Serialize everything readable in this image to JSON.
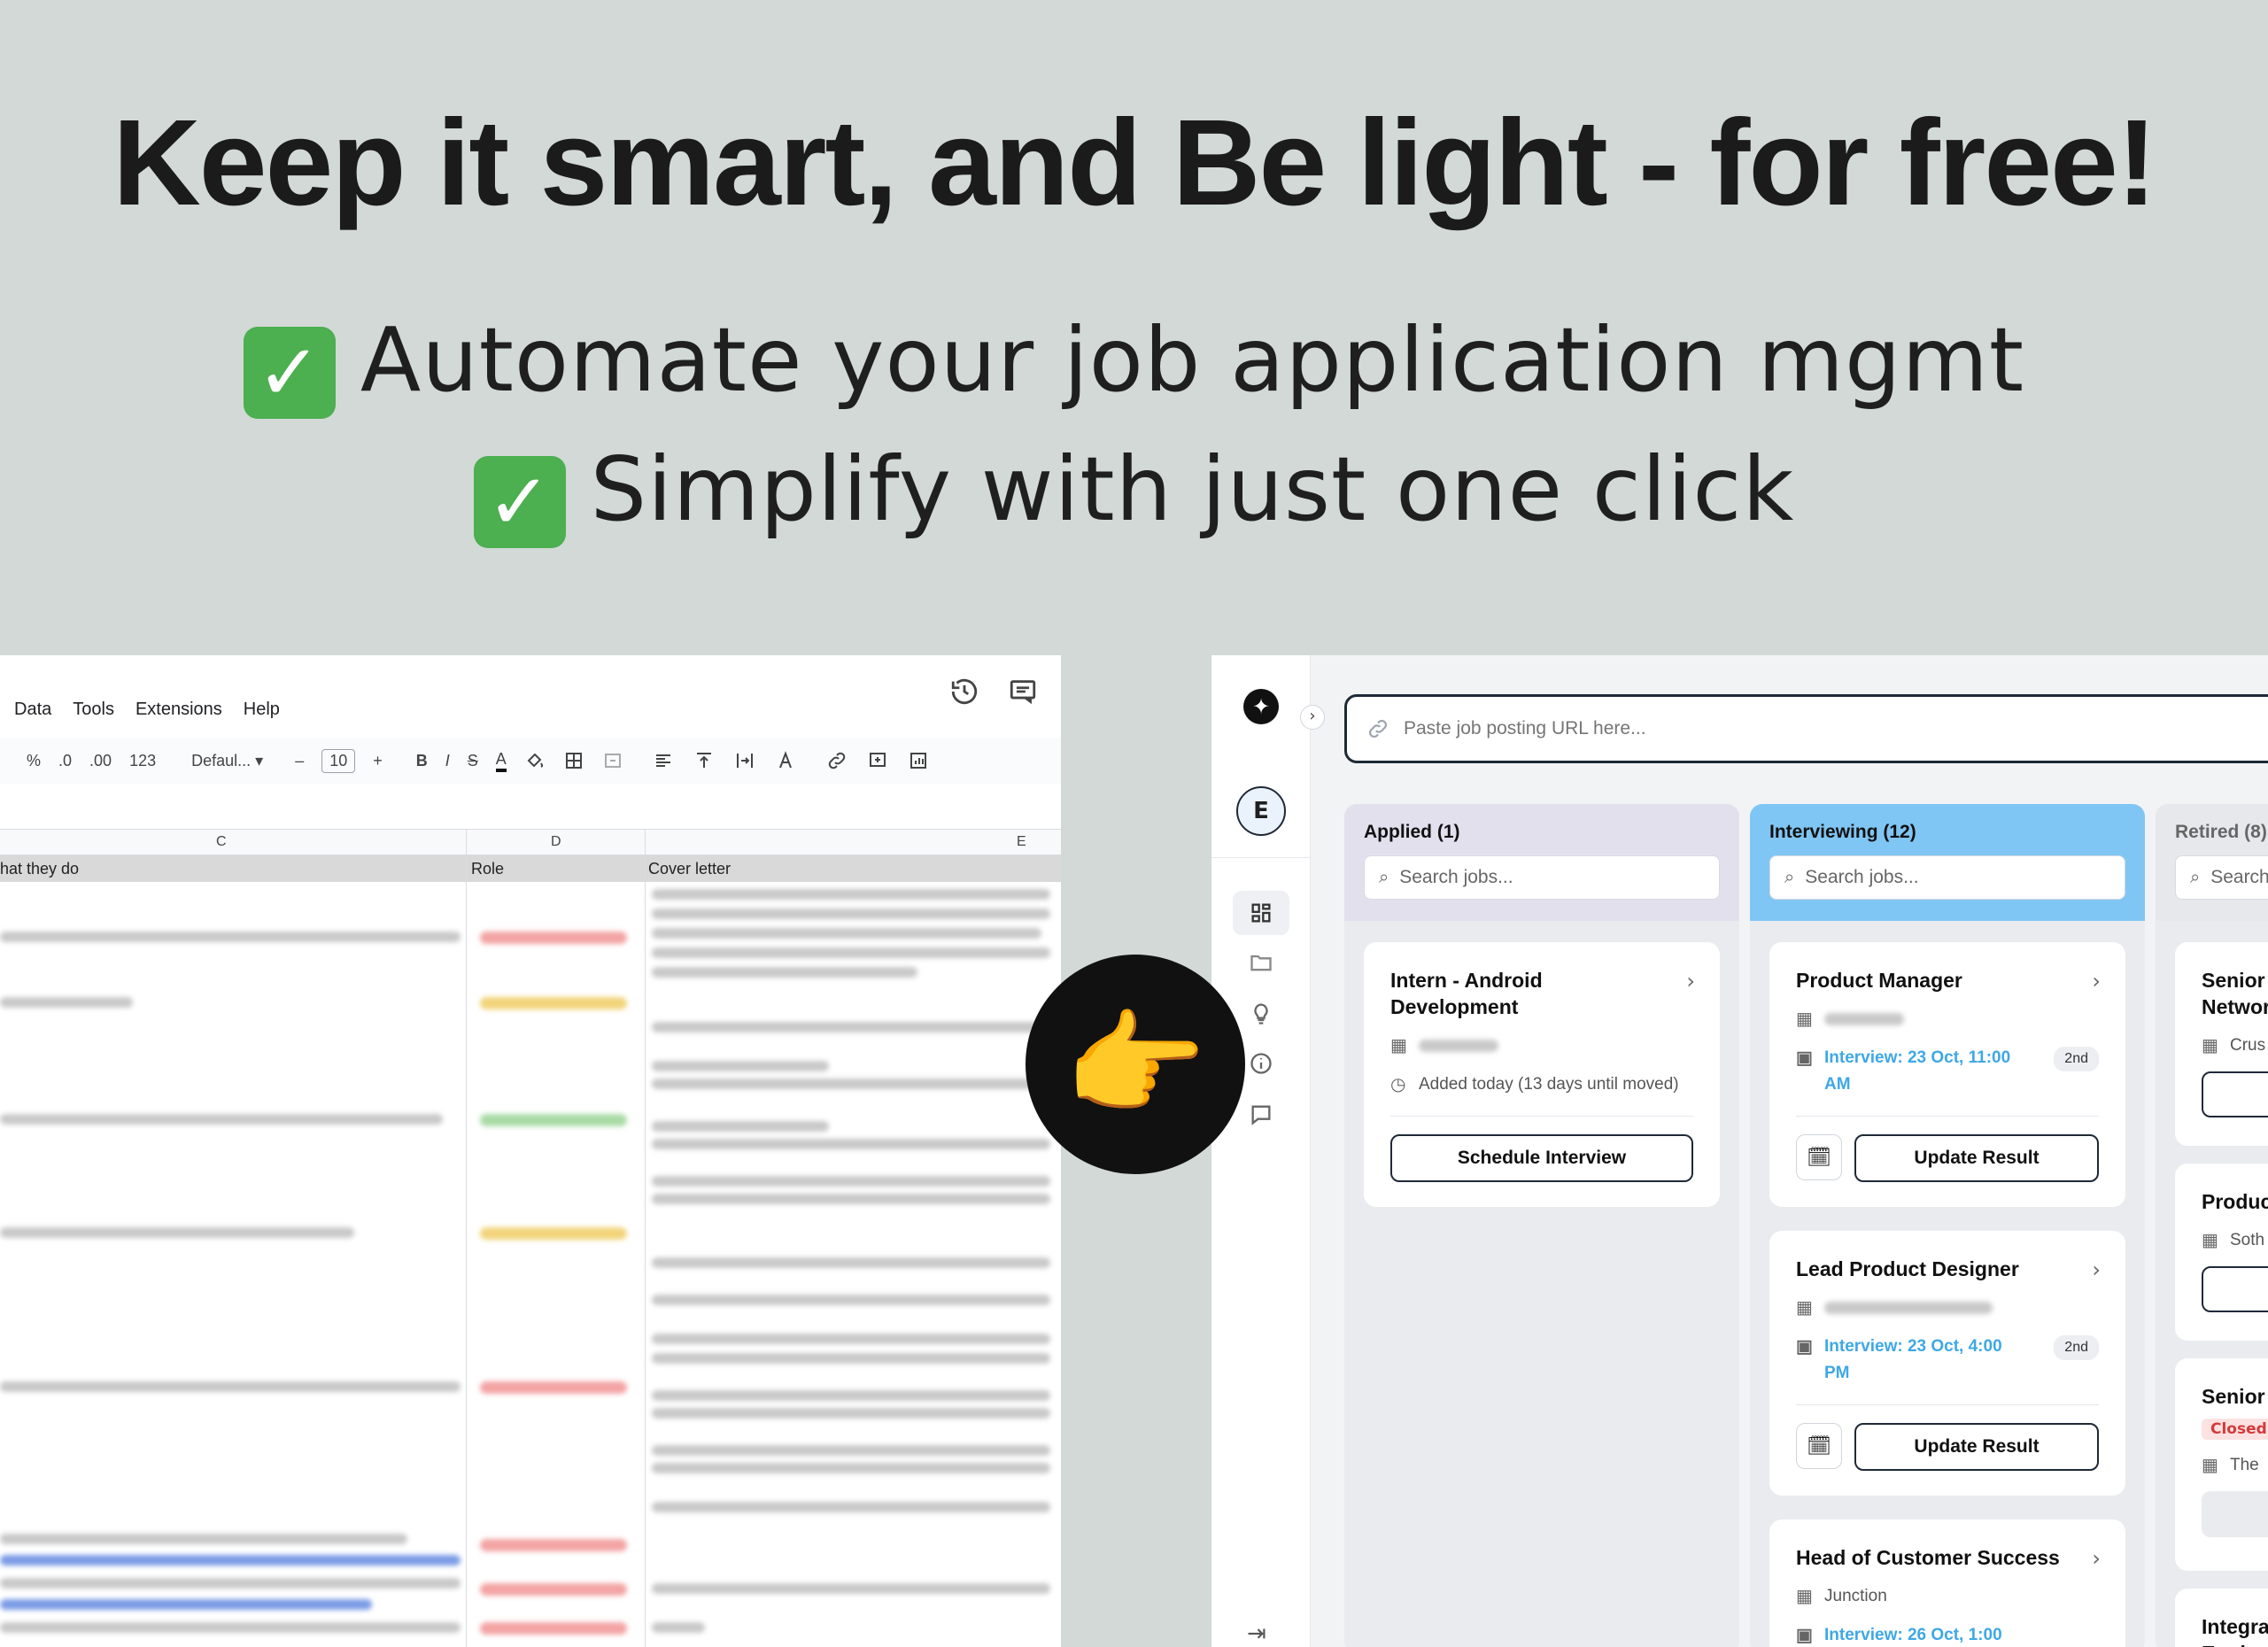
{
  "hero": {
    "title": "Keep it smart, and Be light - for free!",
    "bullets": [
      {
        "check": "✓",
        "text": "Automate your job application mgmt"
      },
      {
        "check": "✓",
        "text": "Simplify with just one click"
      }
    ]
  },
  "sheet": {
    "menu": [
      "Data",
      "Tools",
      "Extensions",
      "Help"
    ],
    "toolbar": {
      "percent": "%",
      "dec_minus": ".0",
      "dec_plus": ".00",
      "num_format": "123",
      "font": "Defaul...",
      "font_size": "10",
      "minus": "–",
      "plus": "+",
      "bold": "B",
      "italic": "I",
      "strike": "S",
      "textcolor": "A"
    },
    "columns": [
      "C",
      "D",
      "E"
    ],
    "headers": [
      "hat they do",
      "Role",
      "Cover letter"
    ]
  },
  "pointer": {
    "emoji": "👉"
  },
  "app": {
    "avatar_initial": "E",
    "url_placeholder": "Paste job posting URL here...",
    "columns": [
      {
        "title": "Applied (1)",
        "color": "#e3e0ee",
        "search_placeholder": "Search jobs...",
        "cards": [
          {
            "title": "Intern - Android Development",
            "added": "Added today (13 days until moved)",
            "button": "Schedule Interview"
          }
        ]
      },
      {
        "title": "Interviewing (12)",
        "color": "#80c6f4",
        "search_placeholder": "Search jobs...",
        "cards": [
          {
            "title": "Product Manager",
            "interview": "Interview: 23 Oct, 11:00 AM",
            "round": "2nd",
            "button": "Update Result"
          },
          {
            "title": "Lead Product Designer",
            "interview": "Interview: 23 Oct, 4:00 PM",
            "round": "2nd",
            "button": "Update Result"
          },
          {
            "title": "Head of Customer Success",
            "company": "Junction",
            "interview": "Interview: 26 Oct, 1:00"
          }
        ]
      },
      {
        "title": "Retired (8)",
        "color": "#e6e8eb",
        "search_placeholder": "Search",
        "cards": [
          {
            "title": "Senior",
            "title2": "Networ",
            "company": "Crus"
          },
          {
            "title": "Produc",
            "company": "Soth"
          },
          {
            "title": "Senior",
            "status": "Closed",
            "company": "The"
          },
          {
            "title": "Integra",
            "title2": "Engine"
          }
        ]
      }
    ]
  }
}
